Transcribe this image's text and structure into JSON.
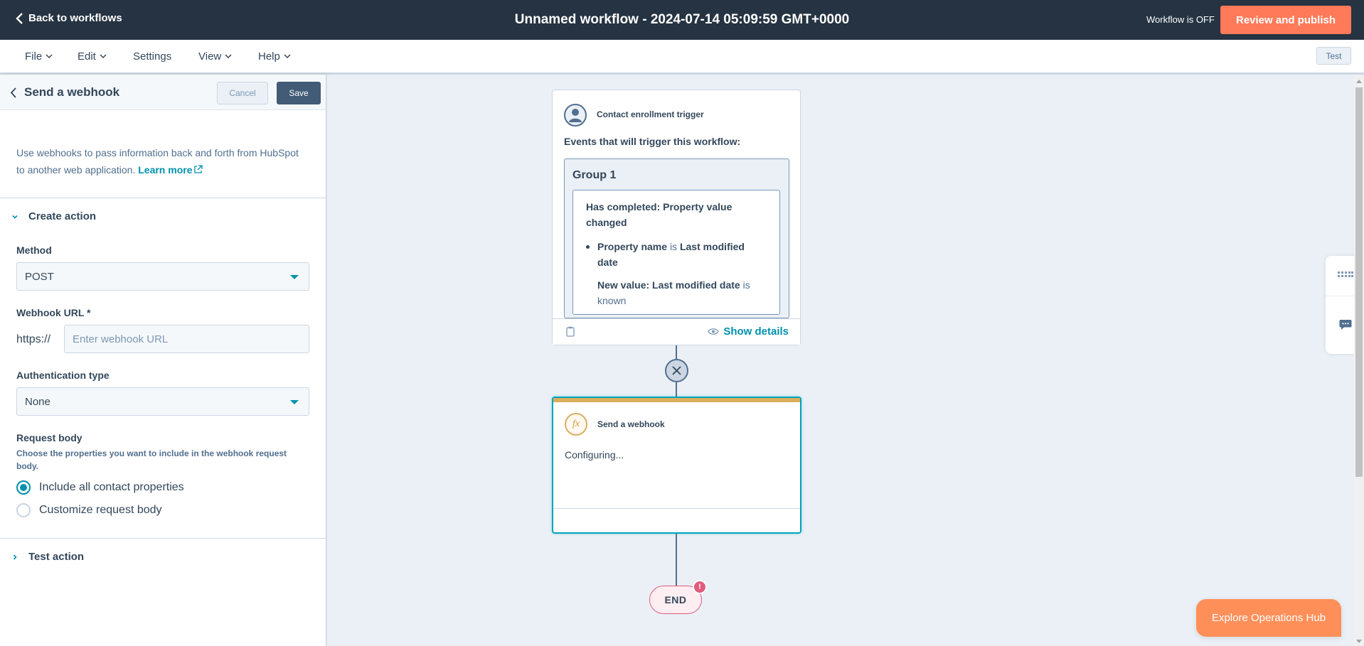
{
  "topbar": {
    "back_label": "Back to workflows",
    "title": "Unnamed workflow - 2024-07-14 05:09:59 GMT+0000",
    "status": "Workflow is OFF",
    "publish_label": "Review and publish"
  },
  "menu": {
    "items": [
      {
        "label": "File",
        "has_dropdown": true
      },
      {
        "label": "Edit",
        "has_dropdown": true
      },
      {
        "label": "Settings",
        "has_dropdown": false
      },
      {
        "label": "View",
        "has_dropdown": true
      },
      {
        "label": "Help",
        "has_dropdown": true
      }
    ],
    "test_label": "Test"
  },
  "panel": {
    "title": "Send a webhook",
    "cancel_label": "Cancel",
    "save_label": "Save",
    "intro": "Use webhooks to pass information back and forth from HubSpot to another web application.",
    "learn_more": "Learn more",
    "create_section": "Create action",
    "method": {
      "label": "Method",
      "value": "POST"
    },
    "webhook_url": {
      "label": "Webhook URL *",
      "prefix": "https://",
      "value": "",
      "placeholder": "Enter webhook URL"
    },
    "auth": {
      "label": "Authentication type",
      "value": "None"
    },
    "request_body": {
      "label": "Request body",
      "help": "Choose the properties you want to include in the webhook request body.",
      "options": [
        {
          "label": "Include all contact properties",
          "checked": true
        },
        {
          "label": "Customize request body",
          "checked": false
        }
      ]
    },
    "test_section": "Test action"
  },
  "canvas": {
    "trigger": {
      "title": "Contact enrollment trigger",
      "events_label": "Events that will trigger this workflow:",
      "group_title": "Group 1",
      "filter_head": "Has completed: Property value changed",
      "filter_prop_label": "Property name",
      "filter_is": "is",
      "filter_prop_value": "Last modified date",
      "filter_new_value": "New value: Last modified date",
      "filter_new_is": "is",
      "filter_known": "known",
      "show_details": "Show details"
    },
    "action": {
      "icon_text": "fx",
      "title": "Send a webhook",
      "status": "Configuring..."
    },
    "end": {
      "label": "END",
      "alert": "!"
    }
  },
  "explore_label": "Explore Operations Hub",
  "colors": {
    "topbar": "#253342",
    "accent_orange": "#ff7a59",
    "link_teal": "#0091ae",
    "action_bar": "#dbae5d",
    "end_alert": "#e15b7d"
  }
}
